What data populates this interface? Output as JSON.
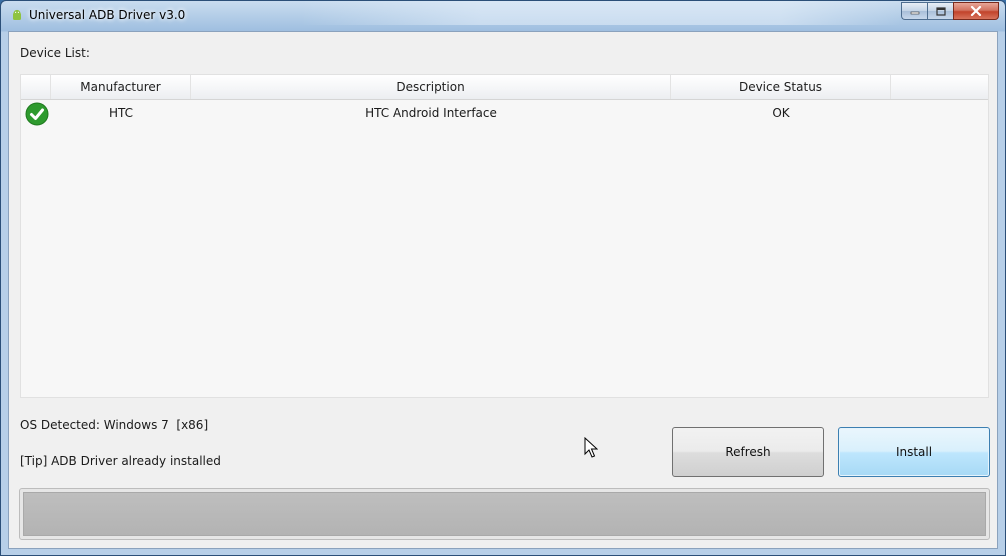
{
  "window": {
    "title": "Universal ADB Driver v3.0",
    "icon": "android-icon",
    "controls": [
      "minimize-icon",
      "maximize-icon",
      "close-icon"
    ]
  },
  "device_list": {
    "label": "Device List:",
    "columns": [
      "",
      "Manufacturer",
      "Description",
      "Device Status"
    ],
    "rows": [
      {
        "status_icon": "check-circle-icon",
        "status_color": "#2e9a2e",
        "manufacturer": "HTC",
        "description": "HTC Android Interface",
        "device_status": "OK"
      }
    ]
  },
  "os_info": {
    "text": "OS Detected: Windows 7  [x86]"
  },
  "tip": {
    "text": "[Tip] ADB Driver already installed"
  },
  "buttons": {
    "refresh_label": "Refresh",
    "install_label": "Install"
  },
  "progress": {
    "value": 0
  },
  "colors": {
    "accent": "#3c7fb1",
    "success": "#2e9a2e"
  }
}
